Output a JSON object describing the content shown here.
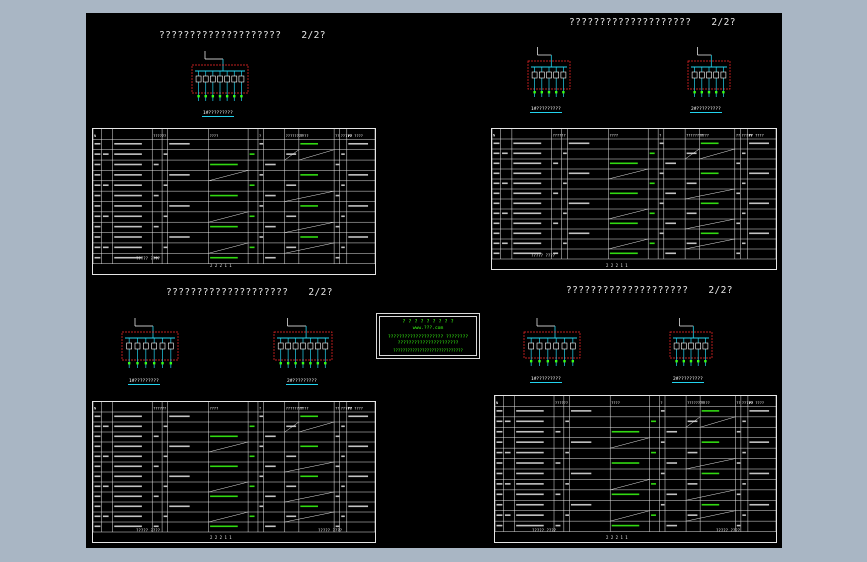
{
  "colors": {
    "background": "#000000",
    "frame": "#a9b6c4",
    "line": "#e5e5e5",
    "bus": "#22d3ee",
    "box": "#ff2a2a",
    "text_green": "#39ff14",
    "text_white": "#ffffff"
  },
  "sheets": [
    {
      "title": "????????????????????",
      "page": "2/2?",
      "diagrams": [
        {
          "caption": "1#?????????"
        }
      ]
    },
    {
      "title": "????????????????????",
      "page": "2/2?",
      "diagrams": [
        {
          "caption": "1#?????????"
        },
        {
          "caption": "2#?????????"
        }
      ]
    },
    {
      "title": "????????????????????",
      "page": "2/2?",
      "diagrams": [
        {
          "caption": "1#?????????"
        },
        {
          "caption": "2#?????????"
        }
      ]
    },
    {
      "title": "????????????????????",
      "page": "2/2?",
      "diagrams": [
        {
          "caption": "1#?????????"
        },
        {
          "caption": "2#?????????"
        }
      ]
    }
  ],
  "table": {
    "header_cells": [
      "N",
      "??????",
      "????",
      "?",
      "????????",
      "????",
      "??",
      "?????",
      "P? ????",
      "??"
    ],
    "footer_left": "????? ????",
    "footer_right": "????? ????",
    "footer_pages": "2 2 2 1 1"
  },
  "stamp": {
    "line1": "? ? ? ?   ? ? ?  ? ?",
    "line2": "www.???.com",
    "line3": "???????????????????? ????????",
    "line4": "??????????????????????",
    "line5": "?????????????????????????????"
  }
}
